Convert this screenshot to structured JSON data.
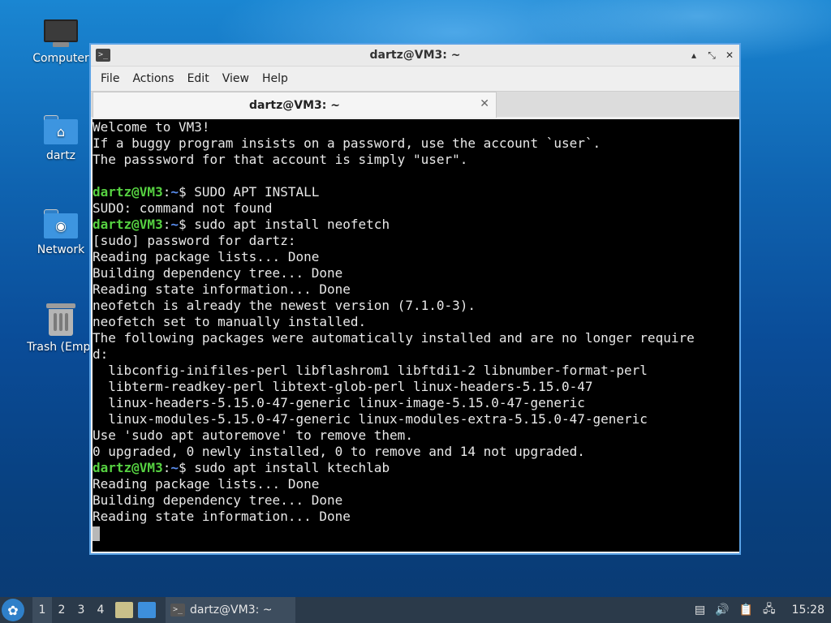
{
  "desktop": {
    "icons": [
      {
        "label": "Computer"
      },
      {
        "label": "dartz"
      },
      {
        "label": "Network"
      },
      {
        "label": "Trash (Empt"
      }
    ]
  },
  "window": {
    "title": "dartz@VM3: ~",
    "controls": {
      "minimize": "▴",
      "maximize": "⤡",
      "close": "✕"
    },
    "menu": [
      "File",
      "Actions",
      "Edit",
      "View",
      "Help"
    ],
    "tab": {
      "title": "dartz@VM3: ~",
      "close": "✕"
    }
  },
  "terminal": {
    "prompt_user": "dartz@VM3",
    "prompt_sep": ":",
    "prompt_path": "~",
    "lines": [
      {
        "type": "text",
        "text": "Welcome to VM3!"
      },
      {
        "type": "text",
        "text": "If a buggy program insists on a password, use the account `user`."
      },
      {
        "type": "text",
        "text": "The passsword for that account is simply \"user\"."
      },
      {
        "type": "text",
        "text": ""
      },
      {
        "type": "prompt",
        "text": "$ SUDO APT INSTALL"
      },
      {
        "type": "text",
        "text": "SUDO: command not found"
      },
      {
        "type": "prompt",
        "text": "$ sudo apt install neofetch"
      },
      {
        "type": "text",
        "text": "[sudo] password for dartz:"
      },
      {
        "type": "text",
        "text": "Reading package lists... Done"
      },
      {
        "type": "text",
        "text": "Building dependency tree... Done"
      },
      {
        "type": "text",
        "text": "Reading state information... Done"
      },
      {
        "type": "text",
        "text": "neofetch is already the newest version (7.1.0-3)."
      },
      {
        "type": "text",
        "text": "neofetch set to manually installed."
      },
      {
        "type": "text",
        "text": "The following packages were automatically installed and are no longer require"
      },
      {
        "type": "text",
        "text": "d:"
      },
      {
        "type": "text",
        "text": "  libconfig-inifiles-perl libflashrom1 libftdi1-2 libnumber-format-perl"
      },
      {
        "type": "text",
        "text": "  libterm-readkey-perl libtext-glob-perl linux-headers-5.15.0-47"
      },
      {
        "type": "text",
        "text": "  linux-headers-5.15.0-47-generic linux-image-5.15.0-47-generic"
      },
      {
        "type": "text",
        "text": "  linux-modules-5.15.0-47-generic linux-modules-extra-5.15.0-47-generic"
      },
      {
        "type": "text",
        "text": "Use 'sudo apt autoremove' to remove them."
      },
      {
        "type": "text",
        "text": "0 upgraded, 0 newly installed, 0 to remove and 14 not upgraded."
      },
      {
        "type": "prompt",
        "text": "$ sudo apt install ktechlab"
      },
      {
        "type": "text",
        "text": "Reading package lists... Done"
      },
      {
        "type": "text",
        "text": "Building dependency tree... Done"
      },
      {
        "type": "text",
        "text": "Reading state information... Done"
      }
    ]
  },
  "taskbar": {
    "workspaces": [
      "1",
      "2",
      "3",
      "4"
    ],
    "active_workspace": "1",
    "task_label": "dartz@VM3: ~",
    "clock": "15:28"
  },
  "colors": {
    "prompt_user": "#56d141",
    "prompt_path": "#5a8ef0",
    "window_border": "#5ba3e6",
    "taskbar_bg": "#2b3a4a"
  }
}
